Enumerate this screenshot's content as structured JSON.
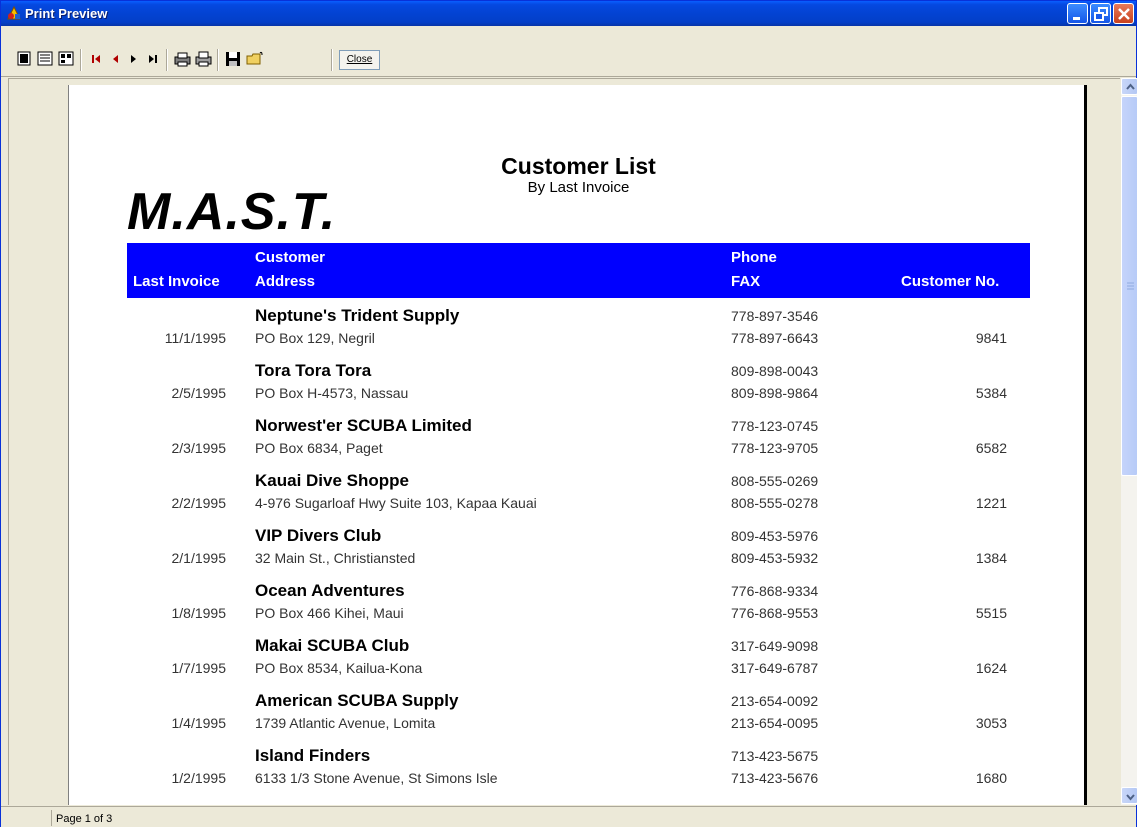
{
  "window": {
    "title": "Print Preview"
  },
  "toolbar": {
    "close_label": "Close",
    "icons": [
      "one-page-icon",
      "two-pages-icon",
      "four-pages-icon",
      "first-page-icon",
      "prev-page-icon",
      "next-page-icon",
      "last-page-icon",
      "print-setup-icon",
      "print-icon",
      "save-icon",
      "open-icon"
    ]
  },
  "report": {
    "title": "Customer List",
    "subtitle": "By Last Invoice",
    "logo": "M.A.S.T.",
    "headers": {
      "last_invoice": "Last Invoice",
      "customer": "Customer",
      "address": "Address",
      "phone": "Phone",
      "fax": "FAX",
      "customer_no": "Customer No."
    },
    "rows": [
      {
        "name": "Neptune's Trident Supply",
        "date": "11/1/1995",
        "address": "PO Box 129, Negril",
        "phone": "778-897-3546",
        "fax": "778-897-6643",
        "custno": "9841"
      },
      {
        "name": "Tora Tora Tora",
        "date": "2/5/1995",
        "address": "PO Box H-4573, Nassau",
        "phone": "809-898-0043",
        "fax": "809-898-9864",
        "custno": "5384"
      },
      {
        "name": "Norwest'er SCUBA Limited",
        "date": "2/3/1995",
        "address": "PO Box 6834, Paget",
        "phone": "778-123-0745",
        "fax": "778-123-9705",
        "custno": "6582"
      },
      {
        "name": "Kauai Dive Shoppe",
        "date": "2/2/1995",
        "address": "4-976 Sugarloaf Hwy Suite 103, Kapaa Kauai",
        "phone": "808-555-0269",
        "fax": "808-555-0278",
        "custno": "1221"
      },
      {
        "name": "VIP Divers Club",
        "date": "2/1/1995",
        "address": "32 Main St., Christiansted",
        "phone": "809-453-5976",
        "fax": "809-453-5932",
        "custno": "1384"
      },
      {
        "name": "Ocean Adventures",
        "date": "1/8/1995",
        "address": "PO Box 466 Kihei, Maui",
        "phone": "776-868-9334",
        "fax": "776-868-9553",
        "custno": "5515"
      },
      {
        "name": "Makai SCUBA Club",
        "date": "1/7/1995",
        "address": "PO Box 8534, Kailua-Kona",
        "phone": "317-649-9098",
        "fax": "317-649-6787",
        "custno": "1624"
      },
      {
        "name": "American SCUBA Supply",
        "date": "1/4/1995",
        "address": "1739 Atlantic Avenue, Lomita",
        "phone": "213-654-0092",
        "fax": "213-654-0095",
        "custno": "3053"
      },
      {
        "name": "Island Finders",
        "date": "1/2/1995",
        "address": "6133 1/3 Stone Avenue, St Simons Isle",
        "phone": "713-423-5675",
        "fax": "713-423-5676",
        "custno": "1680"
      }
    ]
  },
  "status": {
    "page": "Page 1 of 3"
  },
  "colors": {
    "header_bg": "#0000ff",
    "titlebar": "#0343d2"
  }
}
